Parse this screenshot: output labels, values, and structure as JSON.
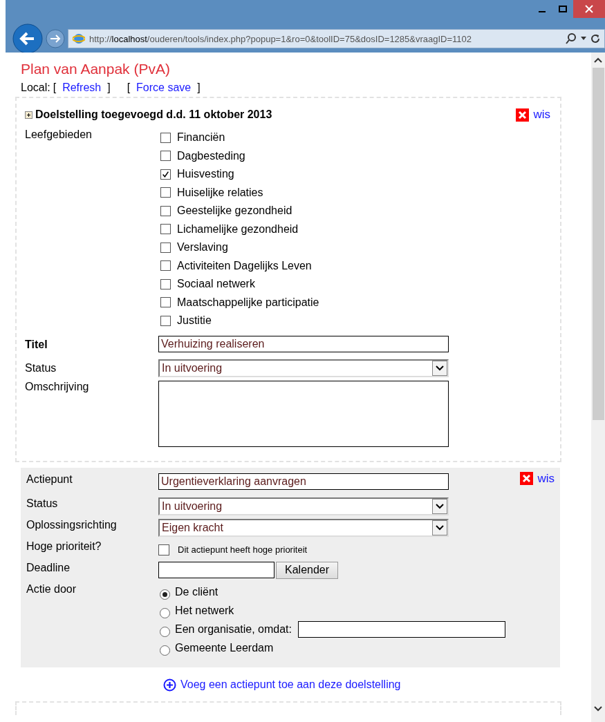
{
  "browser": {
    "url": "http://**localhost**/ouderen/tools/index.php?popup=1&ro=0&toolID=75&dosID=1285&vraagID=1102"
  },
  "page": {
    "title": "Plan van Aanpak (PvA)",
    "local_label": "Local:",
    "links": [
      {
        "before": "[",
        "label": "Refresh",
        "after": "]"
      },
      {
        "before": "[",
        "label": "Force save",
        "after": "]"
      }
    ]
  },
  "goal": {
    "heading": "Doelstelling toegevoegd d.d. 11 oktober 2013",
    "delete": "wis",
    "areas_label": "Leefgebieden",
    "areas": [
      {
        "label": "Financiën",
        "checked": false
      },
      {
        "label": "Dagbesteding",
        "checked": false
      },
      {
        "label": "Huisvesting",
        "checked": true
      },
      {
        "label": "Huiselijke relaties",
        "checked": false
      },
      {
        "label": "Geestelijke gezondheid",
        "checked": false
      },
      {
        "label": "Lichamelijke gezondheid",
        "checked": false
      },
      {
        "label": "Verslaving",
        "checked": false
      },
      {
        "label": "Activiteiten Dagelijks Leven",
        "checked": false
      },
      {
        "label": "Sociaal netwerk",
        "checked": false
      },
      {
        "label": "Maatschappelijke participatie",
        "checked": false
      },
      {
        "label": "Justitie",
        "checked": false
      }
    ],
    "fields": [
      {
        "label": "Titel",
        "kind": "text",
        "bold": true,
        "value": "Verhuizing realiseren"
      },
      {
        "label": "Status",
        "kind": "select",
        "bold": false,
        "value": "In uitvoering"
      },
      {
        "label": "Omschrijving",
        "kind": "textarea",
        "bold": false
      }
    ]
  },
  "action": {
    "delete": "wis",
    "fields": [
      {
        "label": "Actiepunt",
        "kind": "text",
        "value": "Urgentieverklaring aanvragen"
      },
      {
        "label": "Status",
        "kind": "select",
        "value": "In uitvoering"
      },
      {
        "label": "Oplossingsrichting",
        "kind": "select",
        "value": "Eigen kracht"
      },
      {
        "label": "Hoge prioriteit?",
        "kind": "checkbox",
        "text": "Dit actiepunt heeft hoge prioriteit",
        "checked": false
      },
      {
        "label": "Deadline",
        "kind": "date",
        "button": "Kalender"
      }
    ],
    "actor": {
      "label": "Actie door",
      "options": [
        {
          "label": "De cliënt",
          "kind": "plain",
          "selected": true
        },
        {
          "label": "Het netwerk",
          "kind": "plain",
          "selected": false
        },
        {
          "label": "Een organisatie, omdat:",
          "kind": "with_input",
          "selected": false
        },
        {
          "label": "Gemeente Leerdam",
          "kind": "plain",
          "selected": false
        }
      ]
    }
  },
  "add_link": "Voeg een actiepunt toe aan deze doelstelling"
}
